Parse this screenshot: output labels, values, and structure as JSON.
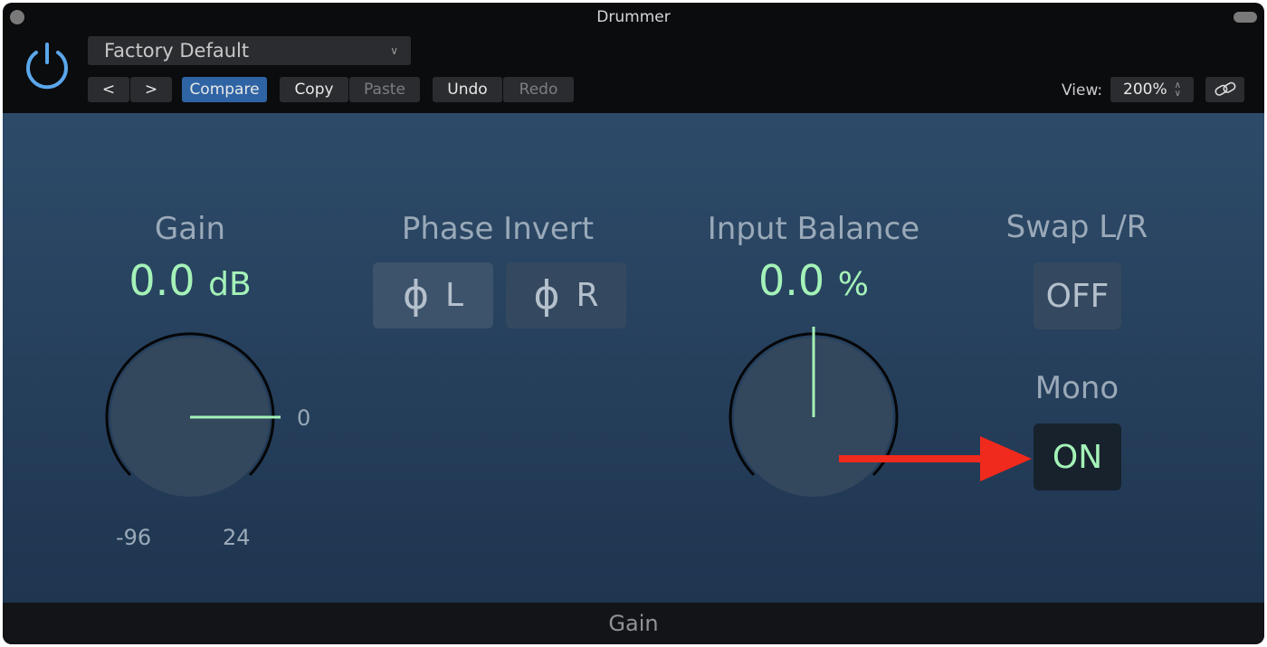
{
  "window": {
    "title": "Drummer"
  },
  "header": {
    "preset": "Factory Default",
    "prev": "<",
    "next": ">",
    "compare": "Compare",
    "copy": "Copy",
    "paste": "Paste",
    "undo": "Undo",
    "redo": "Redo",
    "view_label": "View:",
    "view_value": "200%"
  },
  "gain": {
    "label": "Gain",
    "value": "0.0",
    "unit": "dB",
    "min": "-96",
    "max": "24",
    "center": "0",
    "level_db": 0
  },
  "phase": {
    "label": "Phase Invert",
    "left": "L",
    "right": "R"
  },
  "balance": {
    "label": "Input Balance",
    "value": "0.0",
    "unit": "%",
    "level_percent": 0
  },
  "swap": {
    "label": "Swap L/R",
    "state": "OFF"
  },
  "mono": {
    "label": "Mono",
    "state": "ON"
  },
  "footer": {
    "text": "Gain"
  },
  "colors": {
    "accent": "#a4f2b8",
    "compare": "#2f64a4",
    "power": "#5aa7ea",
    "arrow": "#f02a1c"
  }
}
